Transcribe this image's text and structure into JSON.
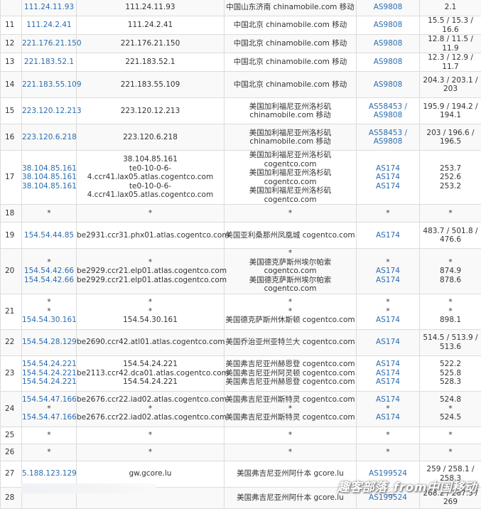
{
  "watermark": "趣客部落_from中国移动",
  "rows": [
    {
      "hop": "",
      "h": 24,
      "ip": [
        "111.24.11.93"
      ],
      "host": [
        "111.24.11.93"
      ],
      "loc": [
        "中国山东济南 chinamobile.com 移动"
      ],
      "asn": [
        "AS9808"
      ],
      "lat": [
        "2.1"
      ]
    },
    {
      "hop": "11",
      "h": 25,
      "ip": [
        "111.24.2.41"
      ],
      "host": [
        "111.24.2.41"
      ],
      "loc": [
        "中国北京 chinamobile.com 移动"
      ],
      "asn": [
        "AS9808"
      ],
      "lat": [
        "15.5 / 15.3 / 16.6"
      ]
    },
    {
      "hop": "12",
      "h": 25,
      "ip": [
        "221.176.21.150"
      ],
      "host": [
        "221.176.21.150"
      ],
      "loc": [
        "中国北京 chinamobile.com 移动"
      ],
      "asn": [
        "AS9808"
      ],
      "lat": [
        "12.8 / 11.5 / 11.9"
      ]
    },
    {
      "hop": "13",
      "h": 25,
      "ip": [
        "221.183.52.1"
      ],
      "host": [
        "221.183.52.1"
      ],
      "loc": [
        "中国北京 chinamobile.com 移动"
      ],
      "asn": [
        "AS9808"
      ],
      "lat": [
        "12.3 / 12.9 / 11.7"
      ]
    },
    {
      "hop": "14",
      "h": 37,
      "ip": [
        "221.183.55.109"
      ],
      "host": [
        "221.183.55.109"
      ],
      "loc": [
        "中国北京 chinamobile.com 移动"
      ],
      "asn": [
        "AS9808"
      ],
      "lat": [
        "204.3 / 203.1 /",
        "203"
      ]
    },
    {
      "hop": "15",
      "h": 37,
      "ip": [
        "223.120.12.213"
      ],
      "host": [
        "223.120.12.213"
      ],
      "loc": [
        "美国加利福尼亚州洛杉矶",
        "chinamobile.com 移动"
      ],
      "asn": [
        "AS58453 /",
        "AS9808"
      ],
      "lat": [
        "195.9 / 194.2 /",
        "194.1"
      ]
    },
    {
      "hop": "16",
      "h": 37,
      "ip": [
        "223.120.6.218"
      ],
      "host": [
        "223.120.6.218"
      ],
      "loc": [
        "美国加利福尼亚州洛杉矶",
        "chinamobile.com 移动"
      ],
      "asn": [
        "AS58453 /",
        "AS9808"
      ],
      "lat": [
        "203 / 196.6 /",
        "196.5"
      ]
    },
    {
      "hop": "17",
      "h": 75,
      "ip": [
        "38.104.85.161",
        "38.104.85.161",
        "38.104.85.161"
      ],
      "host": [
        "38.104.85.161",
        "te0-10-0-6-",
        "4.ccr41.lax05.atlas.cogentco.com",
        "te0-10-0-6-",
        "4.ccr41.lax05.atlas.cogentco.com"
      ],
      "loc": [
        "美国加利福尼亚州洛杉矶 cogentco.com",
        "美国加利福尼亚州洛杉矶 cogentco.com",
        "美国加利福尼亚州洛杉矶 cogentco.com"
      ],
      "asn": [
        "AS174",
        "AS174",
        "AS174"
      ],
      "lat": [
        "253.7",
        "252.6",
        "253.2"
      ]
    },
    {
      "hop": "18",
      "h": 25,
      "ip": [
        "*"
      ],
      "host": [
        "*"
      ],
      "loc": [
        "*"
      ],
      "asn": [
        "*"
      ],
      "lat": [
        "*"
      ]
    },
    {
      "hop": "19",
      "h": 37,
      "ip": [
        "154.54.44.85"
      ],
      "host": [
        "be2931.ccr31.phx01.atlas.cogentco.com"
      ],
      "loc": [
        "美国亚利桑那州凤凰城 cogentco.com"
      ],
      "asn": [
        "AS174"
      ],
      "lat": [
        "483.7 / 501.8 /",
        "476.6"
      ]
    },
    {
      "hop": "20",
      "h": 50,
      "ip": [
        "*",
        "154.54.42.66",
        "154.54.42.66"
      ],
      "host": [
        "*",
        "be2929.ccr21.elp01.atlas.cogentco.com",
        "be2929.ccr21.elp01.atlas.cogentco.com"
      ],
      "loc": [
        "*",
        "美国德克萨斯州埃尔帕索 cogentco.com",
        "美国德克萨斯州埃尔帕索 cogentco.com"
      ],
      "asn": [
        "*",
        "AS174",
        "AS174"
      ],
      "lat": [
        "*",
        "874.9",
        "878.6"
      ]
    },
    {
      "hop": "21",
      "h": 50,
      "ip": [
        "*",
        "*",
        "154.54.30.161"
      ],
      "host": [
        "*",
        "*",
        "154.54.30.161"
      ],
      "loc": [
        "*",
        "*",
        "美国德克萨斯州休斯顿 cogentco.com"
      ],
      "asn": [
        "*",
        "*",
        "AS174"
      ],
      "lat": [
        "*",
        "*",
        "898.1"
      ]
    },
    {
      "hop": "22",
      "h": 37,
      "ip": [
        "154.54.28.129"
      ],
      "host": [
        "be2690.ccr42.atl01.atlas.cogentco.com"
      ],
      "loc": [
        "美国乔治亚州亚特兰大 cogentco.com"
      ],
      "asn": [
        "AS174"
      ],
      "lat": [
        "514.5 / 513.9 /",
        "513.6"
      ]
    },
    {
      "hop": "23",
      "h": 50,
      "ip": [
        "154.54.24.221",
        "154.54.24.221",
        "154.54.24.221"
      ],
      "host": [
        "154.54.24.221",
        "be2113.ccr42.dca01.atlas.cogentco.com",
        "154.54.24.221"
      ],
      "loc": [
        "美国弗吉尼亚州赫恩登 cogentco.com",
        "美国弗吉尼亚州阿灵顿 cogentco.com",
        "美国弗吉尼亚州赫恩登 cogentco.com"
      ],
      "asn": [
        "AS174",
        "AS174",
        "AS174"
      ],
      "lat": [
        "522.2",
        "525.8",
        "528.3"
      ]
    },
    {
      "hop": "24",
      "h": 50,
      "ip": [
        "154.54.47.166",
        "*",
        "154.54.47.166"
      ],
      "host": [
        "be2676.ccr22.iad02.atlas.cogentco.com",
        "*",
        "be2676.ccr22.iad02.atlas.cogentco.com"
      ],
      "loc": [
        "美国弗吉尼亚州斯特灵 cogentco.com",
        "*",
        "美国弗吉尼亚州斯特灵 cogentco.com"
      ],
      "asn": [
        "AS174",
        "*",
        "AS174"
      ],
      "lat": [
        "524.8",
        "*",
        "524.5"
      ]
    },
    {
      "hop": "25",
      "h": 24,
      "ip": [
        "*"
      ],
      "host": [
        "*"
      ],
      "loc": [
        "*"
      ],
      "asn": [
        "*"
      ],
      "lat": [
        "*"
      ]
    },
    {
      "hop": "26",
      "h": 24,
      "ip": [
        "*"
      ],
      "host": [
        "*"
      ],
      "loc": [
        "*"
      ],
      "asn": [
        "*"
      ],
      "lat": [
        "*"
      ]
    },
    {
      "hop": "27",
      "h": 37,
      "ip": [
        "5.188.123.129"
      ],
      "host": [
        "gw.gcore.lu"
      ],
      "loc": [
        "美国弗吉尼亚州阿什本 gcore.lu"
      ],
      "asn": [
        "AS199524"
      ],
      "lat": [
        "259 / 258.1 /",
        "258.3"
      ]
    },
    {
      "hop": "28",
      "h": 30,
      "ip": [
        ""
      ],
      "host": [
        ""
      ],
      "loc": [
        "美国弗吉尼亚州阿什本 gcore.lu"
      ],
      "asn": [
        "AS199524"
      ],
      "lat": [
        "268.2 / 267.3 /",
        "269"
      ]
    }
  ]
}
